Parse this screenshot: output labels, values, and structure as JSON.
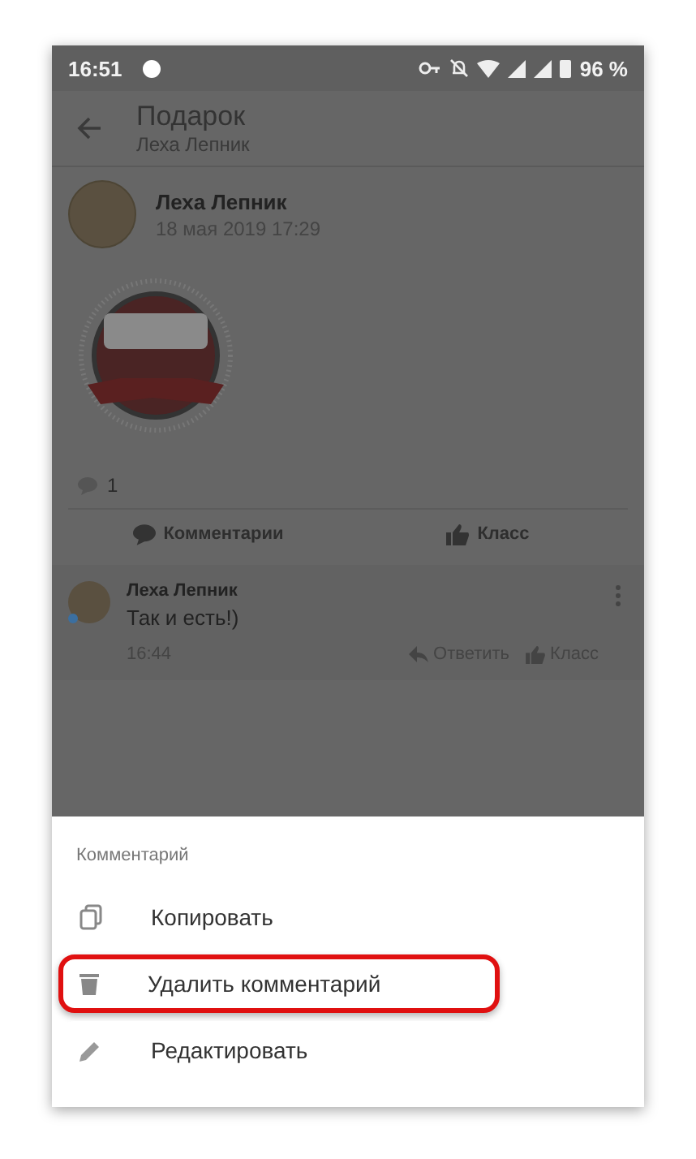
{
  "status_bar": {
    "time": "16:51",
    "battery": "96 %"
  },
  "header": {
    "title": "Подарок",
    "subtitle": "Леха Лепник"
  },
  "post": {
    "author": "Леха Лепник",
    "date": "18 мая 2019 17:29",
    "comment_count": "1",
    "actions": [
      {
        "kind": "comment",
        "label": "Комментарии"
      },
      {
        "kind": "like",
        "label": "Класс"
      }
    ]
  },
  "comment": {
    "author": "Леха Лепник",
    "online": true,
    "text": "Так и есть!)",
    "time": "16:44",
    "actions": [
      {
        "kind": "reply",
        "label": "Ответить"
      },
      {
        "kind": "like",
        "label": "Класс"
      }
    ]
  },
  "sheet": {
    "title": "Комментарий",
    "items": [
      {
        "kind": "copy",
        "label": "Копировать",
        "highlighted": false
      },
      {
        "kind": "delete",
        "label": "Удалить комментарий",
        "highlighted": true
      },
      {
        "kind": "edit",
        "label": "Редактировать",
        "highlighted": false
      }
    ]
  }
}
